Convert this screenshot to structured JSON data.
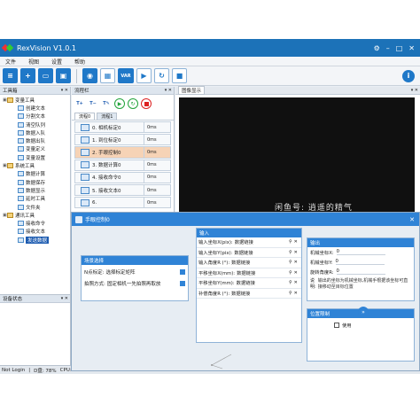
{
  "window": {
    "title": "RexVision V1.0.1",
    "controls": [
      "⚙",
      "–",
      "□",
      "✕"
    ]
  },
  "menu": [
    "文件",
    "视图",
    "设置",
    "帮助"
  ],
  "toolbar": {
    "var_label": "VAR",
    "info": "i"
  },
  "toolbox": {
    "title": "工具箱",
    "items": [
      {
        "label": "变量工具",
        "level": 0,
        "type": "folder"
      },
      {
        "label": "创建文本",
        "level": 1
      },
      {
        "label": "分割文本",
        "level": 1
      },
      {
        "label": "清空队列",
        "level": 1
      },
      {
        "label": "数据入队",
        "level": 1
      },
      {
        "label": "数据出队",
        "level": 1
      },
      {
        "label": "变量定义",
        "level": 1
      },
      {
        "label": "变量设置",
        "level": 1
      },
      {
        "label": "系统工具",
        "level": 0,
        "type": "folder"
      },
      {
        "label": "数据计算",
        "level": 1
      },
      {
        "label": "数据保存",
        "level": 1
      },
      {
        "label": "数据显示",
        "level": 1
      },
      {
        "label": "延时工具",
        "level": 1
      },
      {
        "label": "文件夹",
        "level": 1
      },
      {
        "label": "通讯工具",
        "level": 0,
        "type": "folder"
      },
      {
        "label": "接收命令",
        "level": 1
      },
      {
        "label": "接收文本",
        "level": 1
      },
      {
        "label": "发送数据",
        "level": 1,
        "selected": true
      }
    ]
  },
  "device_panel": {
    "title": "设备状态"
  },
  "statusbar": {
    "login": "Not Login",
    "disk": "D盘: 78%",
    "cpu": "CPU:"
  },
  "flow": {
    "title": "流程栏",
    "tabs": [
      "流程0",
      "流程1"
    ],
    "steps": [
      {
        "label": "0. 相机标定0",
        "time": "0ms"
      },
      {
        "label": "1. 到位标定0",
        "time": "0ms"
      },
      {
        "label": "2. 手眼控制0",
        "time": "0ms",
        "highlight": true
      },
      {
        "label": "3. 数据计算0",
        "time": "0ms"
      },
      {
        "label": "4. 接收命令0",
        "time": "0ms"
      },
      {
        "label": "5. 接收文本0",
        "time": "0ms"
      },
      {
        "label": "6.",
        "time": "0ms"
      }
    ]
  },
  "image_panel": {
    "title": "图像显示"
  },
  "dialog": {
    "title": "手眼控制0",
    "scene": {
      "title": "场景选择",
      "rows": [
        {
          "label": "N点标定:",
          "value": "选择标定矩阵"
        },
        {
          "label": "拍照方式:",
          "value": "固定相机一先拍照再取放"
        }
      ]
    },
    "input": {
      "title": "输入",
      "rows": [
        {
          "label": "输入坐标X(pix):",
          "value": "数据链接"
        },
        {
          "label": "输入坐标Y(pix):",
          "value": "数据链接"
        },
        {
          "label": "输入角度R  (°):",
          "value": "数据链接"
        },
        {
          "label": "平移坐标X(mm):",
          "value": "数据链接"
        },
        {
          "label": "平移坐标Y(mm):",
          "value": "数据链接"
        },
        {
          "label": "补偿角度R  (°):",
          "value": "数据链接"
        }
      ]
    },
    "output": {
      "title": "输出",
      "rows": [
        {
          "label": "机械坐标X:",
          "value": "0"
        },
        {
          "label": "机械坐标Y:",
          "value": "0"
        },
        {
          "label": "旋转角度R:",
          "value": "0"
        }
      ],
      "note_label": "说明:",
      "note": "输出的坐标为机械坐标,机械手根据该坐标可直接移动至目标位置"
    },
    "position": {
      "title": "位置限制",
      "checkbox": "使用"
    },
    "arrow": "»"
  },
  "watermark": "闲鱼号: 逍遥的精气"
}
